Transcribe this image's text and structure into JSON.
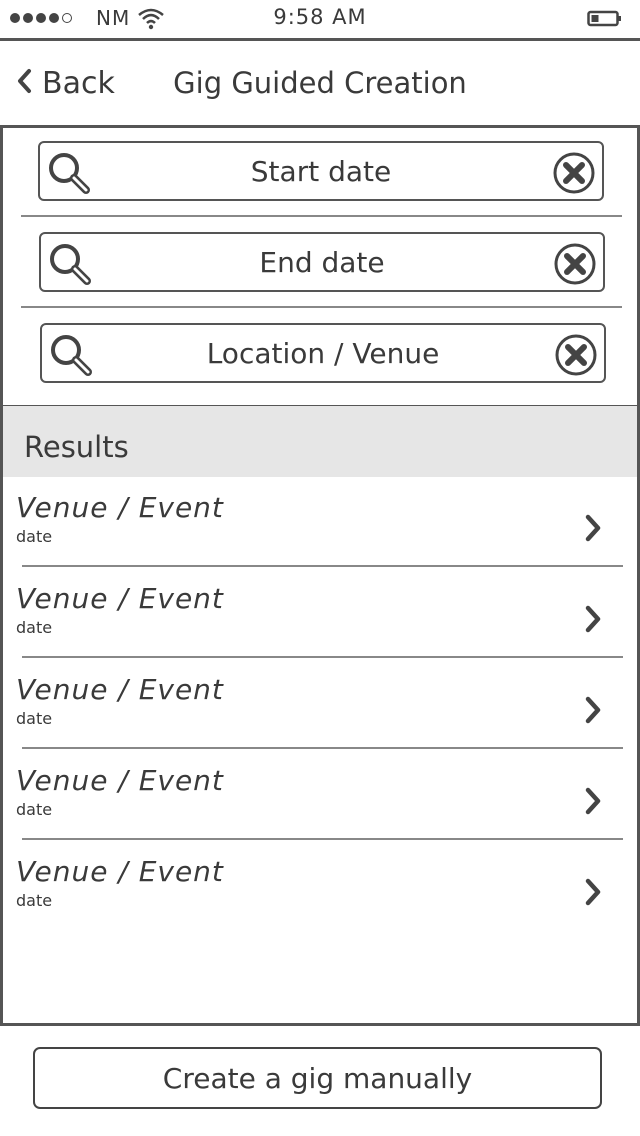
{
  "status_bar": {
    "signal_dots": [
      true,
      true,
      true,
      true,
      false
    ],
    "carrier": "NM",
    "time": "9:58 AM",
    "wifi_icon": "wifi-icon",
    "battery_icon": "battery-icon"
  },
  "nav": {
    "back_label": "Back",
    "back_icon": "chevron-left-icon",
    "title": "Gig Guided Creation"
  },
  "search": {
    "fields": [
      {
        "label": "Start date",
        "icon": "search-icon",
        "clear_icon": "clear-icon"
      },
      {
        "label": "End date",
        "icon": "search-icon",
        "clear_icon": "clear-icon"
      },
      {
        "label": "Location / Venue",
        "icon": "search-icon",
        "clear_icon": "clear-icon"
      }
    ]
  },
  "results": {
    "header": "Results",
    "items": [
      {
        "title": "Venue / Event",
        "subtitle": "date"
      },
      {
        "title": "Venue / Event",
        "subtitle": "date"
      },
      {
        "title": "Venue / Event",
        "subtitle": "date"
      },
      {
        "title": "Venue / Event",
        "subtitle": "date"
      },
      {
        "title": "Venue / Event",
        "subtitle": "date"
      }
    ]
  },
  "footer": {
    "create_manual_label": "Create a gig manually"
  }
}
